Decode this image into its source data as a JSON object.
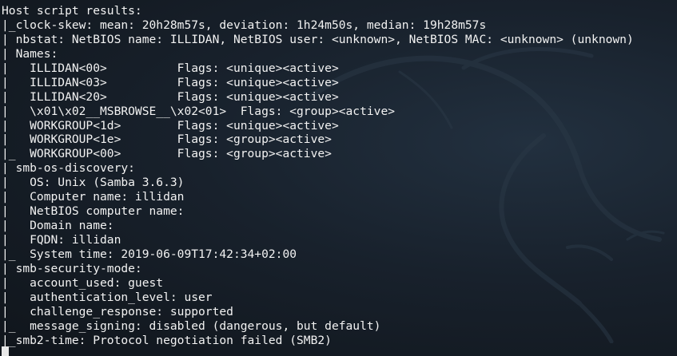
{
  "terminal": {
    "lines": [
      "Host script results:",
      "|_clock-skew: mean: 20h28m57s, deviation: 1h24m50s, median: 19h28m57s",
      "| nbstat: NetBIOS name: ILLIDAN, NetBIOS user: <unknown>, NetBIOS MAC: <unknown> (unknown)",
      "| Names:",
      "|   ILLIDAN<00>          Flags: <unique><active>",
      "|   ILLIDAN<03>          Flags: <unique><active>",
      "|   ILLIDAN<20>          Flags: <unique><active>",
      "|   \\x01\\x02__MSBROWSE__\\x02<01>  Flags: <group><active>",
      "|   WORKGROUP<1d>        Flags: <unique><active>",
      "|   WORKGROUP<1e>        Flags: <group><active>",
      "|_  WORKGROUP<00>        Flags: <group><active>",
      "| smb-os-discovery:",
      "|   OS: Unix (Samba 3.6.3)",
      "|   Computer name: illidan",
      "|   NetBIOS computer name:",
      "|   Domain name:",
      "|   FQDN: illidan",
      "|_  System time: 2019-06-09T17:42:34+02:00",
      "| smb-security-mode:",
      "|   account_used: guest",
      "|   authentication_level: user",
      "|   challenge_response: supported",
      "|_  message_signing: disabled (dangerous, but default)",
      "|_smb2-time: Protocol negotiation failed (SMB2)"
    ]
  },
  "background": {
    "icon": "kali-dragon-logo",
    "color": "#2b3a4a"
  }
}
